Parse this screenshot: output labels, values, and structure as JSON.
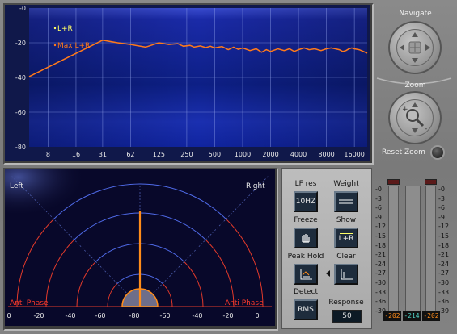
{
  "spectrum": {
    "legend": [
      "L+R",
      "Max L+R"
    ],
    "y_ticks": [
      "-0",
      "-20",
      "-40",
      "-60",
      "-80"
    ],
    "x_ticks": [
      "8",
      "16",
      "31",
      "62",
      "125",
      "250",
      "500",
      "1000",
      "2000",
      "4000",
      "8000",
      "16000"
    ]
  },
  "chart_data": {
    "type": "line",
    "x_scale": "log",
    "xlim": [
      5,
      22000
    ],
    "ylim": [
      -80,
      0
    ],
    "grid": true,
    "legend_position": "top-left",
    "x_ticks": [
      8,
      16,
      31,
      62,
      125,
      250,
      500,
      1000,
      2000,
      4000,
      8000,
      16000
    ],
    "y_ticks": [
      0,
      -20,
      -40,
      -60,
      -80
    ],
    "series": [
      {
        "name": "L+R",
        "color": "#ffff66",
        "x": [],
        "y": []
      },
      {
        "name": "Max L+R",
        "color": "#ff7a1a",
        "x": [
          5,
          31,
          45,
          62,
          90,
          125,
          160,
          200,
          230,
          270,
          300,
          350,
          400,
          450,
          500,
          600,
          700,
          800,
          900,
          1000,
          1200,
          1400,
          1600,
          1800,
          2000,
          2400,
          2800,
          3200,
          3600,
          4000,
          4600,
          5200,
          6000,
          7000,
          8000,
          9000,
          10000,
          11000,
          12000,
          13000,
          14000,
          15000,
          16000,
          18000,
          20000,
          22000
        ],
        "y": [
          -39.5,
          -18.5,
          -20,
          -21,
          -22.5,
          -20,
          -21,
          -20.5,
          -22,
          -21.5,
          -22.5,
          -21.8,
          -22.8,
          -22,
          -23,
          -22.2,
          -24,
          -22.5,
          -23.8,
          -23,
          -24.5,
          -23.5,
          -25.5,
          -24,
          -25,
          -23.5,
          -24.5,
          -23.5,
          -25,
          -24,
          -23,
          -24,
          -23.5,
          -24.5,
          -23.5,
          -23,
          -23.5,
          -24,
          -25,
          -24.5,
          -23.5,
          -23,
          -23.5,
          -24,
          -25,
          -26
        ]
      }
    ]
  },
  "scope": {
    "left_label": "Left",
    "right_label": "Right",
    "anti_phase_left": "Anti Phase",
    "anti_phase_right": "Anti Phase",
    "x_ticks": [
      "0",
      "-20",
      "-40",
      "-60",
      "-80",
      "-60",
      "-40",
      "-20",
      "0"
    ],
    "correlation_value": 0
  },
  "controls": {
    "lf_res": {
      "label": "LF res",
      "value": "10HZ"
    },
    "weight": {
      "label": "Weight"
    },
    "freeze": {
      "label": "Freeze"
    },
    "show": {
      "label": "Show",
      "value": "L+R"
    },
    "peak_hold": {
      "label": "Peak Hold"
    },
    "clear": {
      "label": "Clear"
    },
    "detect": {
      "label": "Detect",
      "value": "RMS"
    },
    "response": {
      "label": "Response",
      "value": "50"
    }
  },
  "navigate": {
    "title": "Navigate"
  },
  "zoom": {
    "title": "Zoom",
    "reset_label": "Reset Zoom"
  },
  "meters": {
    "scale": [
      "-0",
      "-3",
      "-6",
      "-9",
      "-12",
      "-15",
      "-18",
      "-21",
      "-24",
      "-27",
      "-30",
      "-33",
      "-36",
      "-39"
    ],
    "readouts": {
      "left": "-202",
      "center": "-214",
      "right": "-202"
    },
    "colors": {
      "peak_readout": "#ff8c1a",
      "center_readout": "#4fd1c5"
    }
  }
}
